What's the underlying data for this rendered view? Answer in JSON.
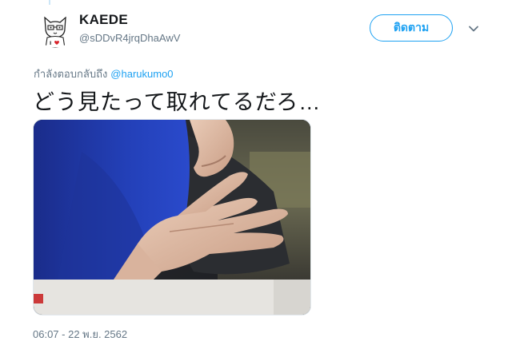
{
  "profile": {
    "display_name": "KAEDE",
    "handle": "@sDDvR4jrqDhaAwV",
    "avatar_icon": "cat-sketch-avatar-icon"
  },
  "actions": {
    "follow_label": "ติดตาม",
    "more_icon": "chevron-down-icon"
  },
  "reply": {
    "prefix": "กำลังตอบกลับถึง",
    "mention": "@harukumo0"
  },
  "tweet": {
    "text": "どう見たって取れてるだろ…",
    "timestamp": "06:07 - 22 พ.ย. 2562"
  },
  "colors": {
    "accent": "#1da1f2",
    "secondary_text": "#657786",
    "primary_text": "#14171a"
  }
}
